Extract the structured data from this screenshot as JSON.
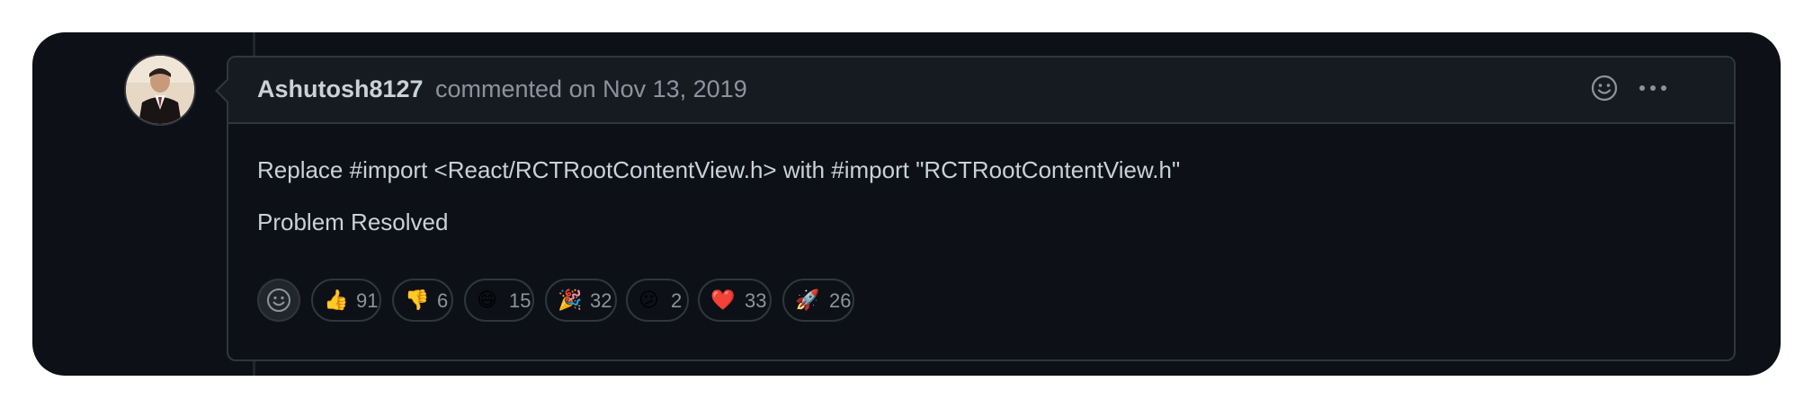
{
  "comment": {
    "author": "Ashutosh8127",
    "meta": "commented on Nov 13, 2019",
    "body_lines": [
      "Replace #import <React/RCTRootContentView.h> with #import \"RCTRootContentView.h\"",
      "Problem Resolved"
    ]
  },
  "header_icons": [
    "smiley-icon",
    "kebab-menu-icon"
  ],
  "reactions": [
    {
      "name": "thumbs-up",
      "emoji": "👍",
      "count": "91"
    },
    {
      "name": "thumbs-down",
      "emoji": "👎",
      "count": "6"
    },
    {
      "name": "laugh",
      "emoji": "😄",
      "count": "15"
    },
    {
      "name": "hooray",
      "emoji": "🎉",
      "count": "32"
    },
    {
      "name": "confused",
      "emoji": "😕",
      "count": "2"
    },
    {
      "name": "heart",
      "emoji": "❤️",
      "count": "33"
    },
    {
      "name": "rocket",
      "emoji": "🚀",
      "count": "26"
    }
  ],
  "colors": {
    "background": "#0d1117",
    "header": "#161b22",
    "border": "#30363d",
    "text": "#c9d1d9",
    "muted": "#8b949e"
  }
}
